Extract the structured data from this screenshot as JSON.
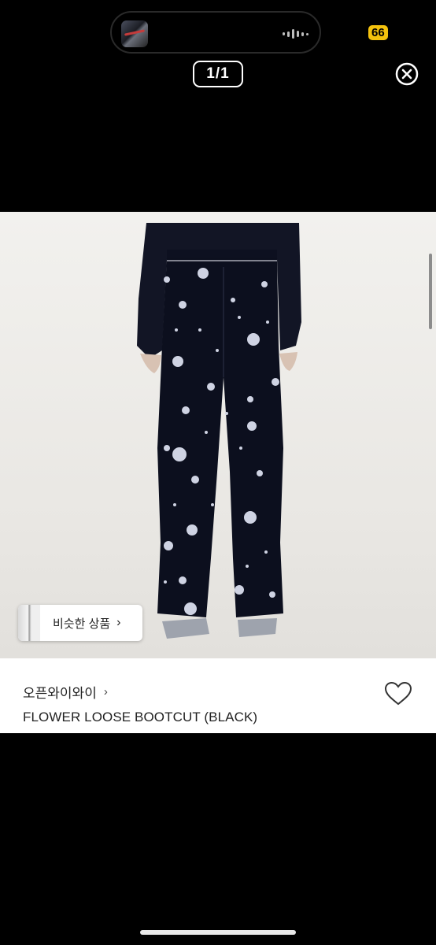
{
  "status": {
    "battery": "66"
  },
  "viewer": {
    "counter": "1/1",
    "close_icon": "close-circle-icon"
  },
  "product": {
    "similar_button": "비슷한 상품",
    "brand": "오픈와이와이",
    "brand_arrow": "›",
    "title": "FLOWER LOOSE BOOTCUT (BLACK)",
    "like_icon": "heart-outline-icon"
  },
  "colors": {
    "background": "#000000",
    "battery": "#f4c20d",
    "panel": "#ffffff",
    "text": "#222222"
  }
}
